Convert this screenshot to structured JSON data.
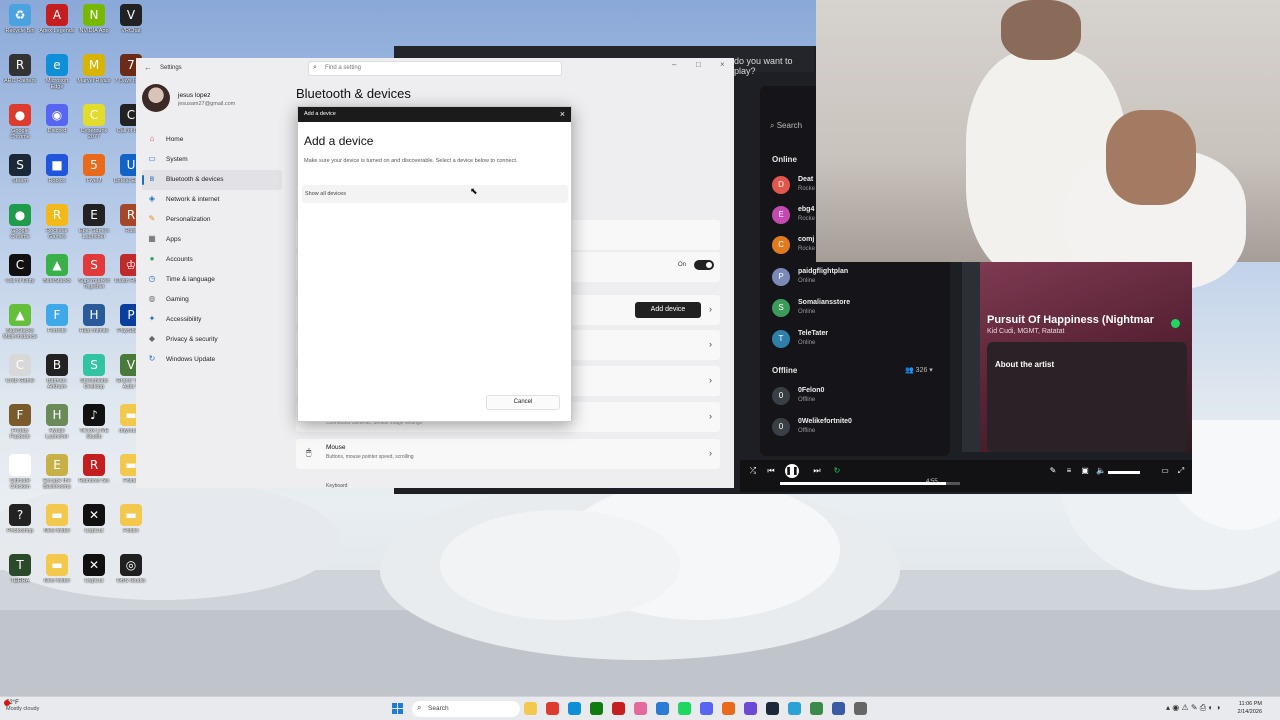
{
  "desktop": {
    "icons": [
      {
        "label": "Recycle Bin",
        "icon": "recycle-bin-icon",
        "color": "#4aa3df",
        "glyph": "♻"
      },
      {
        "label": "Apex Legends",
        "icon": "apex-icon",
        "color": "#c41e1e",
        "glyph": "A"
      },
      {
        "label": "NVIDIA App",
        "icon": "nvidia-icon",
        "color": "#76b900",
        "glyph": "N"
      },
      {
        "label": "VRChat",
        "icon": "vrchat-icon",
        "color": "#222222",
        "glyph": "V"
      },
      {
        "label": "ARC Raiders",
        "icon": "arc-raiders-icon",
        "color": "#333333",
        "glyph": "R"
      },
      {
        "label": "Microsoft Edge",
        "icon": "edge-icon",
        "color": "#0f8fd8",
        "glyph": "e"
      },
      {
        "label": "Marvel Rivals",
        "icon": "marvel-rivals-icon",
        "color": "#d8b400",
        "glyph": "M"
      },
      {
        "label": "7 Days to Die",
        "icon": "7days-icon",
        "color": "#6b2b16",
        "glyph": "7"
      },
      {
        "label": "Google Chrome",
        "icon": "chrome-icon",
        "color": "#de3b2f",
        "glyph": "●"
      },
      {
        "label": "Discord",
        "icon": "discord-icon",
        "color": "#5865f2",
        "glyph": "◉"
      },
      {
        "label": "Cyberpunk 2077",
        "icon": "cyberpunk-icon",
        "color": "#e4dc2a",
        "glyph": "C"
      },
      {
        "label": "Call of Duty",
        "icon": "cod-icon",
        "color": "#222222",
        "glyph": "C"
      },
      {
        "label": "Steam",
        "icon": "steam-icon",
        "color": "#1b2838",
        "glyph": "S"
      },
      {
        "label": "Roblox",
        "icon": "roblox-icon",
        "color": "#2255dd",
        "glyph": "■"
      },
      {
        "label": "FiveM",
        "icon": "fivem-icon",
        "color": "#e86a1a",
        "glyph": "5"
      },
      {
        "label": "Unreal Engine",
        "icon": "unreal-icon",
        "color": "#1263c6",
        "glyph": "U"
      },
      {
        "label": "Google Chrome",
        "icon": "chrome-icon",
        "color": "#1e9c4a",
        "glyph": "●"
      },
      {
        "label": "Rockstar Games",
        "icon": "rockstar-icon",
        "color": "#f3b81a",
        "glyph": "R"
      },
      {
        "label": "Epic Games Launcher",
        "icon": "epic-games-icon",
        "color": "#222222",
        "glyph": "E"
      },
      {
        "label": "Rust",
        "icon": "rust-icon",
        "color": "#a5472a",
        "glyph": "R"
      },
      {
        "label": "Call of Duty",
        "icon": "cod-icon",
        "color": "#111111",
        "glyph": "C"
      },
      {
        "label": "BlueStacks",
        "icon": "bluestacks-icon",
        "color": "#3ab04a",
        "glyph": "▲"
      },
      {
        "label": "Supermarket Together",
        "icon": "supermarket-icon",
        "color": "#e23a3a",
        "glyph": "S"
      },
      {
        "label": "Clash Royale",
        "icon": "clash-icon",
        "color": "#c02a2a",
        "glyph": "♔"
      },
      {
        "label": "BlueStacks Multi-Instance",
        "icon": "bluestacks-multi-icon",
        "color": "#64c03a",
        "glyph": "▲"
      },
      {
        "label": "Fortnite",
        "icon": "fortnite-icon",
        "color": "#3fa8e8",
        "glyph": "F"
      },
      {
        "label": "Halo Infinite",
        "icon": "halo-icon",
        "color": "#2a5a9a",
        "glyph": "H"
      },
      {
        "label": "PlayStation",
        "icon": "playstation-icon",
        "color": "#0a3f9e",
        "glyph": "P"
      },
      {
        "label": "Crab Game",
        "icon": "crab-game-icon",
        "color": "#d8d8d8",
        "glyph": "C"
      },
      {
        "label": "Batman: Arkham",
        "icon": "batman-icon",
        "color": "#222222",
        "glyph": "B"
      },
      {
        "label": "Streamlabs Desktop",
        "icon": "streamlabs-icon",
        "color": "#31c3a2",
        "glyph": "S"
      },
      {
        "label": "Grand Theft Auto V",
        "icon": "gta-icon",
        "color": "#4a7a3a",
        "glyph": "V"
      },
      {
        "label": "Freddy Fazbear",
        "icon": "fnaf-icon",
        "color": "#7a5a2a",
        "glyph": "F"
      },
      {
        "label": "Hytale Launcher",
        "icon": "hytale-icon",
        "color": "#6a8a5a",
        "glyph": "H"
      },
      {
        "label": "TikTok LIVE Studio",
        "icon": "tiktok-icon",
        "color": "#111111",
        "glyph": "♪"
      },
      {
        "label": "doyoucop",
        "icon": "folder-icon",
        "color": "#f2c94c",
        "glyph": "▬"
      },
      {
        "label": "Ultimate Chicken",
        "icon": "chicken-icon",
        "color": "#ffffff",
        "glyph": "◕"
      },
      {
        "label": "Escape the Backrooms",
        "icon": "backrooms-icon",
        "color": "#c8b048",
        "glyph": "E"
      },
      {
        "label": "Rainbow Six",
        "icon": "rainbow-six-icon",
        "color": "#c41e1e",
        "glyph": "R"
      },
      {
        "label": "Folder",
        "icon": "folder-icon",
        "color": "#f2c94c",
        "glyph": "▬"
      },
      {
        "label": "Photoshop",
        "icon": "photoshop-icon",
        "color": "#222222",
        "glyph": "?"
      },
      {
        "label": "New folder",
        "icon": "folder-icon",
        "color": "#f2c94c",
        "glyph": "▬"
      },
      {
        "label": "CapCut",
        "icon": "capcut-icon",
        "color": "#111111",
        "glyph": "✕"
      },
      {
        "label": "Folder",
        "icon": "folder-icon",
        "color": "#f2c94c",
        "glyph": "▬"
      },
      {
        "label": "TERRA",
        "icon": "terra-icon",
        "color": "#2a4a2a",
        "glyph": "T"
      },
      {
        "label": "New folder",
        "icon": "folder-icon",
        "color": "#f2c94c",
        "glyph": "▬"
      },
      {
        "label": "CapCut",
        "icon": "capcut-icon",
        "color": "#111111",
        "glyph": "✕"
      },
      {
        "label": "OBS Studio",
        "icon": "obs-icon",
        "color": "#202020",
        "glyph": "◎"
      }
    ]
  },
  "discord": {
    "prompt": "do you want to play?",
    "search": "Search",
    "online_header": "Online",
    "offline_header": "Offline",
    "offline_count": "326",
    "friends_online": [
      {
        "name": "Deat",
        "status": "Rocke",
        "color": "#e2574c",
        "initial": "D"
      },
      {
        "name": "ebg4",
        "status": "Rocke",
        "color": "#c44ab0",
        "initial": "E"
      },
      {
        "name": "comj",
        "status": "Rocke",
        "color": "#e07a1f",
        "initial": "C"
      },
      {
        "name": "paidgflightplan",
        "status": "Online",
        "color": "#7a8ab8",
        "initial": "P"
      },
      {
        "name": "Somaliansstore",
        "status": "Online",
        "color": "#3c9a5a",
        "initial": "S"
      },
      {
        "name": "TeleTater",
        "status": "Online",
        "color": "#2f7fa8",
        "initial": "T"
      }
    ],
    "friends_offline": [
      {
        "name": "0Felon0",
        "status": "Offline",
        "color": "#3a3f46",
        "initial": "0"
      },
      {
        "name": "0Welikefortnite0",
        "status": "Offline",
        "color": "#3a3f46",
        "initial": "0"
      }
    ]
  },
  "spotify": {
    "track": "Pursuit Of Happiness (Nightmar",
    "artist": "Kid Cudi, MGMT, Ratatat",
    "about": "About the artist",
    "duration": "4:55",
    "progress": 0.92
  },
  "settings": {
    "app_name": "Settings",
    "search_placeholder": "Find a setting",
    "user_name": "jesus lopez",
    "user_email": "jesusam27@gmail.com",
    "page_title": "Bluetooth & devices",
    "nav": [
      {
        "label": "Home",
        "icon": "home-icon",
        "glyph": "⌂",
        "color": "#d9534f",
        "active": false
      },
      {
        "label": "System",
        "icon": "system-icon",
        "glyph": "▭",
        "color": "#1a6fc4",
        "active": false
      },
      {
        "label": "Bluetooth & devices",
        "icon": "bluetooth-icon",
        "glyph": "ʙ",
        "color": "#1a6fc4",
        "active": true
      },
      {
        "label": "Network & internet",
        "icon": "network-icon",
        "glyph": "◈",
        "color": "#1a6fc4",
        "active": false
      },
      {
        "label": "Personalization",
        "icon": "personalization-icon",
        "glyph": "✎",
        "color": "#e08a1e",
        "active": false
      },
      {
        "label": "Apps",
        "icon": "apps-icon",
        "glyph": "▦",
        "color": "#555555",
        "active": false
      },
      {
        "label": "Accounts",
        "icon": "accounts-icon",
        "glyph": "●",
        "color": "#2aa26a",
        "active": false
      },
      {
        "label": "Time & language",
        "icon": "time-icon",
        "glyph": "◷",
        "color": "#1a6fc4",
        "active": false
      },
      {
        "label": "Gaming",
        "icon": "gaming-icon",
        "glyph": "◍",
        "color": "#777777",
        "active": false
      },
      {
        "label": "Accessibility",
        "icon": "accessibility-icon",
        "glyph": "✦",
        "color": "#1a6fc4",
        "active": false
      },
      {
        "label": "Privacy & security",
        "icon": "privacy-icon",
        "glyph": "◆",
        "color": "#666666",
        "active": false
      },
      {
        "label": "Windows Update",
        "icon": "update-icon",
        "glyph": "↻",
        "color": "#1a6fc4",
        "active": false
      }
    ],
    "toggle_label": "On",
    "add_device": "Add device",
    "hidden_row_sub": "Connected cameras, default image settings",
    "mouse_title": "Mouse",
    "mouse_sub": "Buttons, mouse pointer speed, scrolling",
    "keyboard_peek": "Keyboard"
  },
  "dialog": {
    "window_title": "Add a device",
    "heading": "Add a device",
    "description": "Make sure your device is turned on and discoverable. Select a device below to connect.",
    "show_all": "Show all devices",
    "cancel": "Cancel"
  },
  "taskbar": {
    "temp": "52°F",
    "weather": "Mostly cloudy",
    "search": "Search",
    "time": "11:06 PM",
    "date": "2/14/2026",
    "apps": [
      {
        "icon": "file-explorer-icon",
        "color": "#f2c94c"
      },
      {
        "icon": "chrome-icon",
        "color": "#de3b2f"
      },
      {
        "icon": "edge-icon",
        "color": "#0f8fd8"
      },
      {
        "icon": "xbox-icon",
        "color": "#107c10"
      },
      {
        "icon": "app-icon",
        "color": "#c41e1e"
      },
      {
        "icon": "app-icon",
        "color": "#e46a9e"
      },
      {
        "icon": "app-icon",
        "color": "#2a7ad6"
      },
      {
        "icon": "spotify-icon",
        "color": "#1ed760"
      },
      {
        "icon": "discord-icon",
        "color": "#5865f2"
      },
      {
        "icon": "app-icon",
        "color": "#e86a1a"
      },
      {
        "icon": "app-icon",
        "color": "#6a4ad6"
      },
      {
        "icon": "steam-icon",
        "color": "#1b2838"
      },
      {
        "icon": "app-icon",
        "color": "#2aa2d6"
      },
      {
        "icon": "app-icon",
        "color": "#3a8a4a"
      },
      {
        "icon": "app-icon",
        "color": "#3a5aa6"
      },
      {
        "icon": "settings-icon",
        "color": "#666666"
      }
    ]
  }
}
